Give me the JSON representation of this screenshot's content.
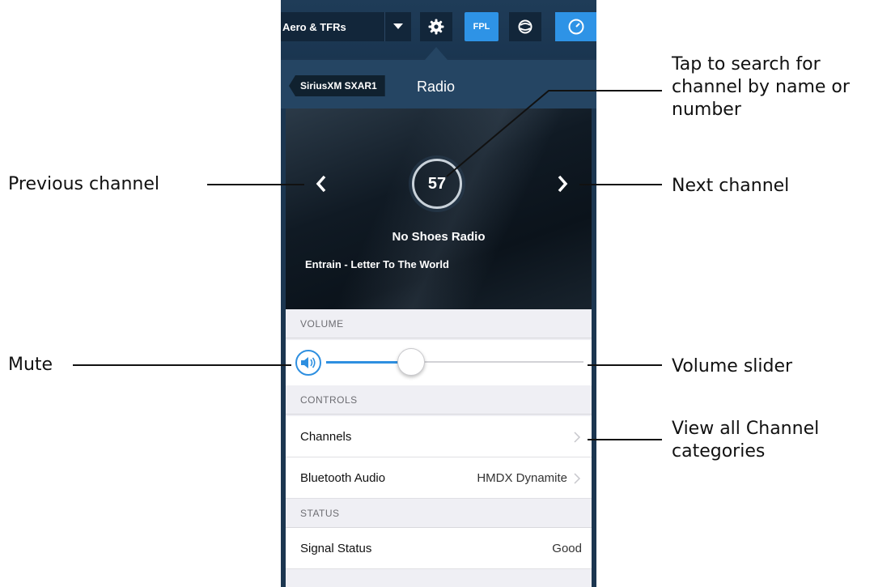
{
  "topbar": {
    "layer_label": "Aero & TFRs",
    "fpl_label": "FPL",
    "accent": "#2e93e6"
  },
  "nav": {
    "back_label": "SiriusXM SXAR1",
    "title": "Radio"
  },
  "now_playing": {
    "channel_number": "57",
    "channel_name": "No Shoes Radio",
    "song": "Entrain - Letter To The World"
  },
  "volume": {
    "section_label": "VOLUME",
    "level": 0.28
  },
  "controls": {
    "section_label": "CONTROLS",
    "channels_label": "Channels",
    "bluetooth_label": "Bluetooth Audio",
    "bluetooth_value": "HMDX Dynamite"
  },
  "status": {
    "section_label": "STATUS",
    "signal_label": "Signal Status",
    "signal_value": "Good"
  },
  "callouts": {
    "search": "Tap to search for channel by name or number",
    "search_lines": [
      "Tap to search for",
      "channel by name or",
      "number"
    ],
    "previous": "Previous channel",
    "next": "Next channel",
    "mute": "Mute",
    "volume_slider": "Volume slider",
    "categories_lines": [
      "View all Channel",
      "categories"
    ]
  },
  "icons": [
    "gear-icon",
    "chevron-down-icon",
    "weather-icon",
    "gauge-icon",
    "chevron-left-icon",
    "chevron-right-icon",
    "speaker-icon"
  ]
}
